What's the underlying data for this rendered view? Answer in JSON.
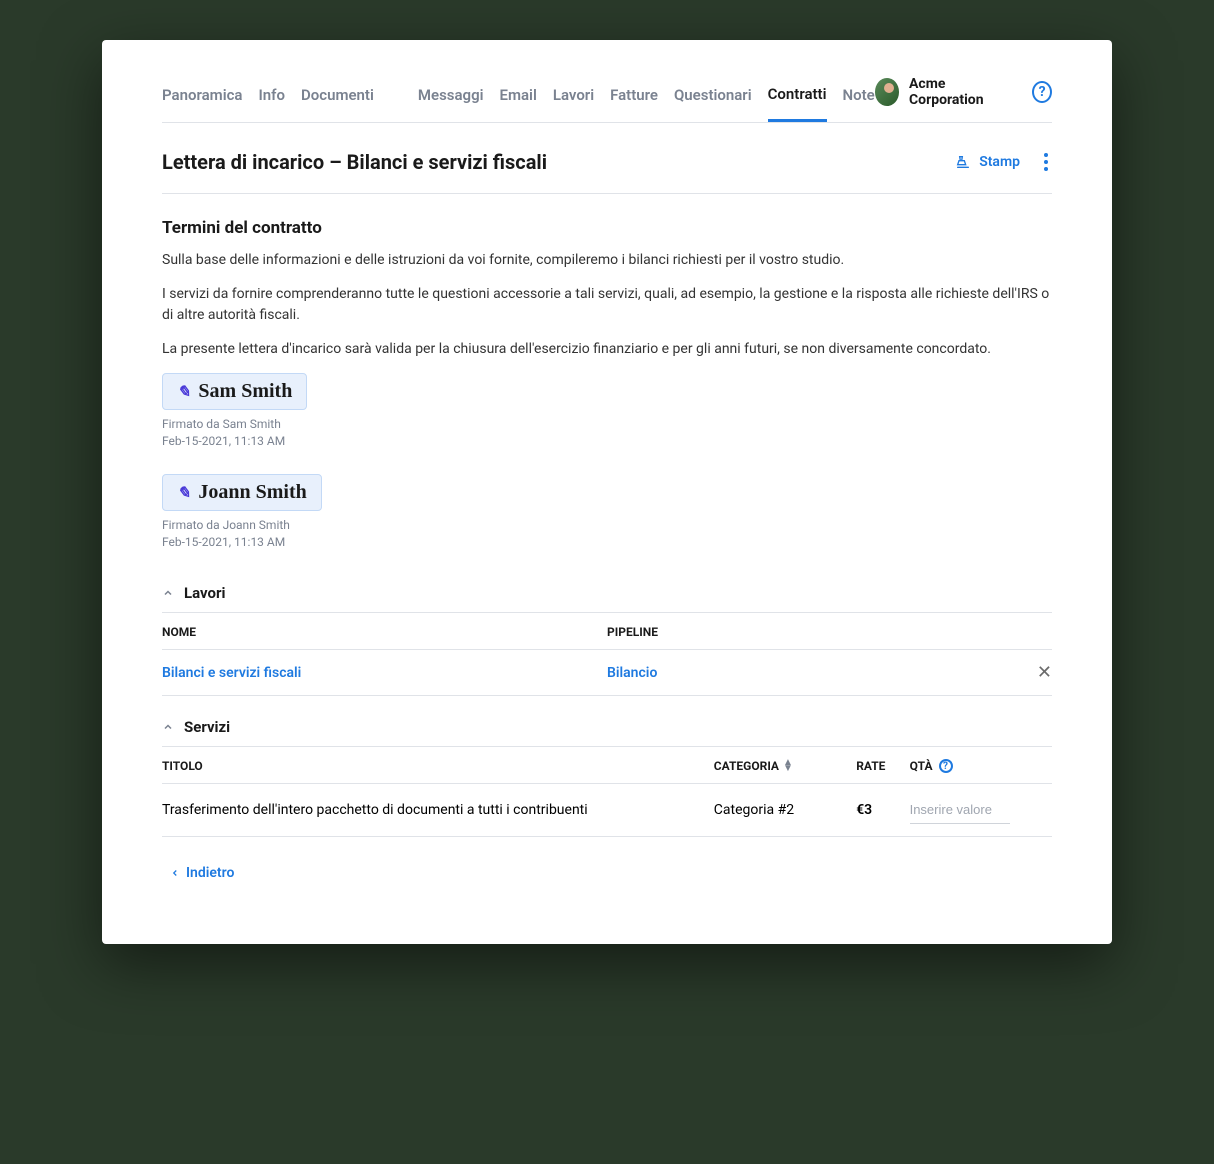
{
  "tabs": [
    {
      "label": "Panoramica",
      "active": false
    },
    {
      "label": "Info",
      "active": false
    },
    {
      "label": "Documenti",
      "active": false
    },
    {
      "label": "Messaggi",
      "active": false
    },
    {
      "label": "Email",
      "active": false
    },
    {
      "label": "Lavori",
      "active": false
    },
    {
      "label": "Fatture",
      "active": false
    },
    {
      "label": "Questionari",
      "active": false
    },
    {
      "label": "Contratti",
      "active": true
    },
    {
      "label": "Note",
      "active": false
    }
  ],
  "account": {
    "name": "Acme Corporation"
  },
  "page": {
    "title": "Lettera di incarico – Bilanci e servizi fiscali",
    "stamp_label": "Stamp"
  },
  "contract_terms": {
    "heading": "Termini del contratto",
    "paragraphs": [
      "Sulla base delle informazioni e delle istruzioni da voi fornite, compileremo i bilanci richiesti per il vostro studio.",
      "I servizi da fornire comprenderanno tutte le questioni accessorie a tali servizi, quali, ad esempio, la gestione e la risposta alle richieste dell'IRS o di altre autorità fiscali.",
      "La presente lettera d'incarico sarà valida per la chiusura dell'esercizio finanziario e per gli anni futuri, se non diversamente concordato."
    ]
  },
  "signatures": [
    {
      "display_name": "Sam Smith",
      "signed_by_line": "Firmato da  Sam Smith",
      "timestamp": "Feb-15-2021, 11:13 AM"
    },
    {
      "display_name": "Joann Smith",
      "signed_by_line": "Firmato da Joann Smith",
      "timestamp": "Feb-15-2021, 11:13 AM"
    }
  ],
  "lavori": {
    "section_title": "Lavori",
    "columns": {
      "nome": "NOME",
      "pipeline": "PIPELINE"
    },
    "rows": [
      {
        "nome": "Bilanci e servizi fiscali",
        "pipeline": "Bilancio"
      }
    ]
  },
  "servizi": {
    "section_title": "Servizi",
    "columns": {
      "titolo": "TITOLO",
      "categoria": "CATEGORIA",
      "rate": "RATE",
      "qta": "QTÀ"
    },
    "rows": [
      {
        "titolo": "Trasferimento dell'intero pacchetto di documenti a tutti i contribuenti",
        "categoria": "Categoria #2",
        "rate": "€3",
        "qta_placeholder": "Inserire valore"
      }
    ]
  },
  "back": {
    "label": "Indietro"
  }
}
